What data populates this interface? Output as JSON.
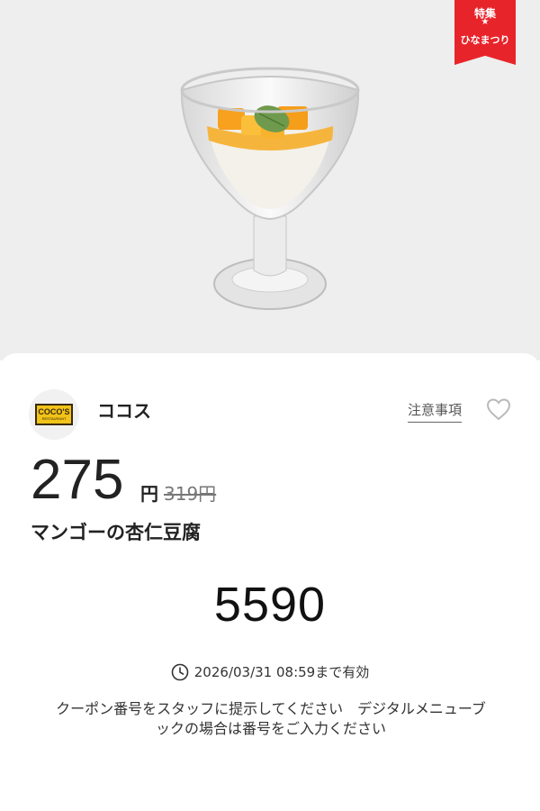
{
  "hero": {
    "image_description": "mango almond tofu dessert in glass",
    "ribbon": {
      "title": "特集",
      "star": "★",
      "subtitle": "ひなまつり"
    }
  },
  "store": {
    "logo": {
      "word": "COCO'S",
      "small": "RESTAURANT"
    },
    "name": "ココス",
    "notice_label": "注意事項",
    "favorite_icon": "heart-outline-icon"
  },
  "offer": {
    "price": "275",
    "price_unit": "円",
    "original_price": "319円",
    "product_name": "マンゴーの杏仁豆腐"
  },
  "coupon": {
    "code": "5590",
    "expiry_icon": "clock-icon",
    "expiry": "2026/03/31 08:59まで有効",
    "instructions_line1": "クーポン番号をスタッフに提示してください　デジタルメニューブ",
    "instructions_line2": "ックの場合は番号をご入力ください"
  },
  "colors": {
    "ribbon": "#e8242b",
    "hero_bg": "#eeeeee",
    "mango": "#f5a623"
  }
}
